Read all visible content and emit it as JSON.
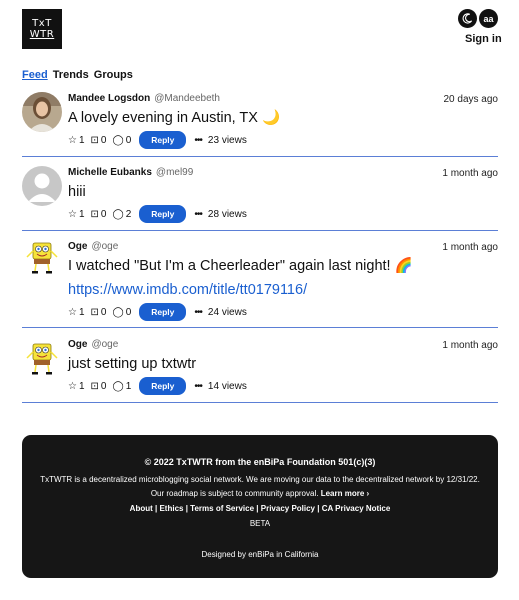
{
  "brand": {
    "line1": "TxT",
    "line2": "WTR"
  },
  "header": {
    "theme_icon": "moon-icon",
    "font_label": "aa",
    "signin_label": "Sign in"
  },
  "tabs": [
    {
      "label": "Feed",
      "active": true
    },
    {
      "label": "Trends",
      "active": false
    },
    {
      "label": "Groups",
      "active": false
    }
  ],
  "posts": [
    {
      "name": "Mandee Logsdon",
      "handle": "@Mandeebeth",
      "time": "20 days ago",
      "text": "A lovely evening in Austin, TX 🌙",
      "link": "",
      "likes": "1",
      "bookmarks": "0",
      "replies": "0",
      "reply_label": "Reply",
      "views": "23 views"
    },
    {
      "name": "Michelle Eubanks",
      "handle": "@mel99",
      "time": "1 month ago",
      "text": "hiii",
      "link": "",
      "likes": "1",
      "bookmarks": "0",
      "replies": "2",
      "reply_label": "Reply",
      "views": "28 views"
    },
    {
      "name": "Oge",
      "handle": "@oge",
      "time": "1 month ago",
      "text": "I watched \"But I'm a Cheerleader\" again last night! 🌈",
      "link": "https://www.imdb.com/title/tt0179116/",
      "likes": "1",
      "bookmarks": "0",
      "replies": "0",
      "reply_label": "Reply",
      "views": "24 views"
    },
    {
      "name": "Oge",
      "handle": "@oge",
      "time": "1 month ago",
      "text": "just setting up txtwtr",
      "link": "",
      "likes": "1",
      "bookmarks": "0",
      "replies": "1",
      "reply_label": "Reply",
      "views": "14 views"
    }
  ],
  "footer": {
    "copyright": "© 2022 TxTWTR from the enBiPa Foundation 501(c)(3)",
    "description": "TxTWTR is a decentralized microblogging social network. We are moving our data to the decentralized network by 12/31/22. Our roadmap is subject to community approval.",
    "learn_more": "Learn more ›",
    "links": [
      "About",
      "Ethics",
      "Terms of Service",
      "Privacy Policy",
      "CA Privacy Notice"
    ],
    "beta": "BETA",
    "designed": "Designed by enBiPa in California"
  }
}
